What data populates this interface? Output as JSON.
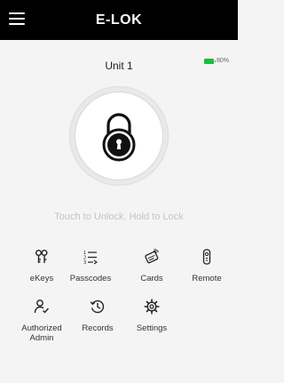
{
  "header": {
    "title": "E-LOK"
  },
  "lock": {
    "unit_name": "Unit 1",
    "battery": "80%",
    "hint": "Touch to Unlock, Hold to Lock"
  },
  "features": [
    {
      "label": "eKeys",
      "icon": "ekeys-icon"
    },
    {
      "label": "Passcodes",
      "icon": "passcodes-icon"
    },
    {
      "label": "Cards",
      "icon": "cards-icon"
    },
    {
      "label": "Remote",
      "icon": "remote-icon"
    },
    {
      "label": "Authorized Admin",
      "icon": "authorized-admin-icon"
    },
    {
      "label": "Records",
      "icon": "records-icon"
    },
    {
      "label": "Settings",
      "icon": "settings-icon"
    }
  ],
  "colors": {
    "header_bg": "#000000",
    "battery": "#16c03a",
    "hint_text": "#c4c4c4"
  }
}
